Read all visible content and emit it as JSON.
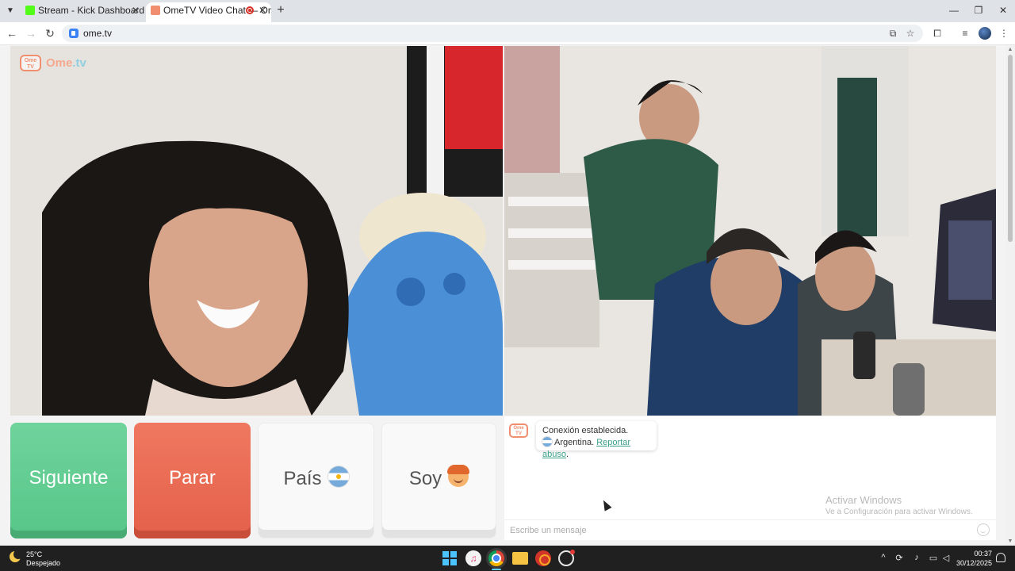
{
  "browser": {
    "tabs": [
      {
        "label": "Stream - Kick Dashboard",
        "favicon": "kick-icon",
        "active": false
      },
      {
        "label": "OmeTV Video Chat — Ome",
        "favicon": "ometv-icon",
        "active": true
      }
    ],
    "url": "ome.tv"
  },
  "page": {
    "logo": {
      "text": "Ome",
      "suffix": ".tv",
      "badge": "Ome TV"
    },
    "buttons": {
      "next": "Siguiente",
      "stop": "Parar",
      "country": "País",
      "gender": "Soy"
    },
    "chat": {
      "badge": "Ome TV",
      "line1": "Conexión establecida.",
      "country": "Argentina.",
      "report": "Reportar abuso",
      "report_end": ".",
      "placeholder": "Escribe un mensaje"
    },
    "watermark": {
      "title": "Activar Windows",
      "subtitle": "Ve a Configuración para activar Windows."
    }
  },
  "taskbar": {
    "temperature": "25°C",
    "weather": "Despejado",
    "time": "00:37",
    "date": "30/12/2025"
  },
  "colors": {
    "next": "#57c688",
    "stop": "#e4604a",
    "report_link": "#3a9f8a",
    "accent": "#60cdff"
  }
}
